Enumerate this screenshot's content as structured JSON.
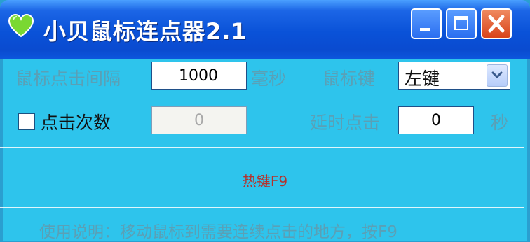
{
  "window": {
    "title": "小贝鼠标连点器2.1",
    "icon": "heart-icon"
  },
  "controls": {
    "interval_label": "鼠标点击间隔",
    "interval_value": "1000",
    "interval_unit": "毫秒",
    "mouse_button_label": "鼠标键",
    "mouse_button_value": "左键",
    "click_count_label": "点击次数",
    "click_count_checked": false,
    "click_count_value": "0",
    "delay_label": "延时点击",
    "delay_value": "0",
    "delay_unit": "秒"
  },
  "hotkey": {
    "text": "热键F9"
  },
  "instructions": {
    "text": "使用说明：移动鼠标到需要连续点击的地方，按F9"
  },
  "colors": {
    "titlebar": "#0a52d8",
    "client_bg": "#2ec4ec",
    "label_muted": "#5aa0b6",
    "hotkey_red": "#b4322c",
    "close_button": "#d8431a"
  }
}
